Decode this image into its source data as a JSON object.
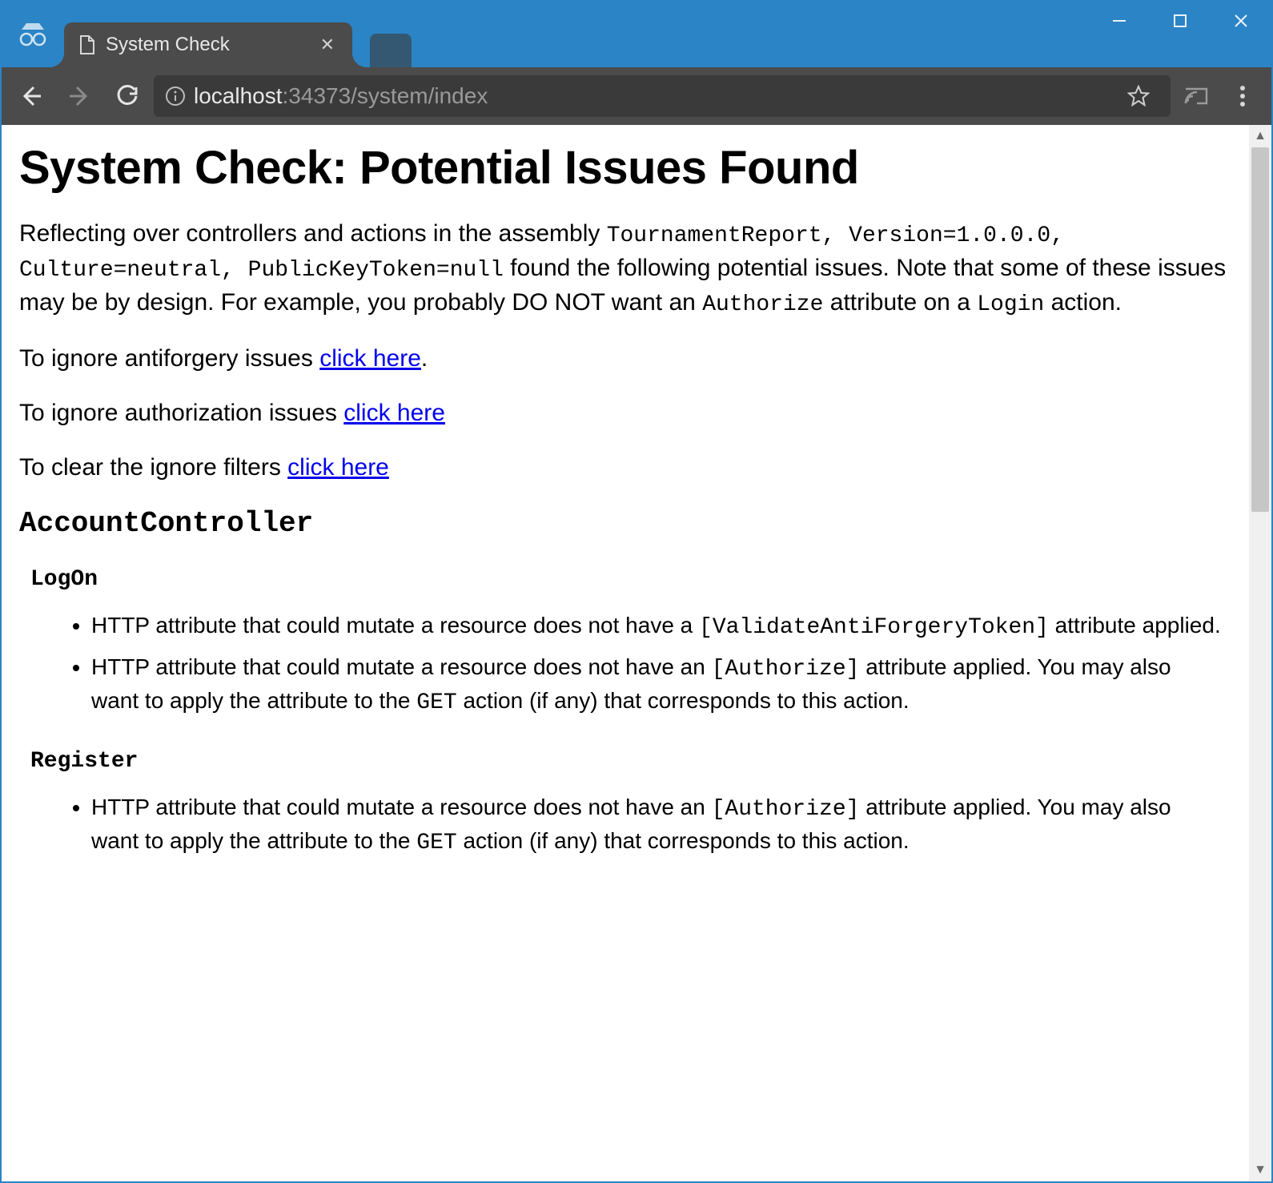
{
  "window": {
    "tab_title": "System Check",
    "url_host": "localhost",
    "url_rest": ":34373/system/index"
  },
  "page": {
    "h1": "System Check: Potential Issues Found",
    "intro_part1": "Reflecting over controllers and actions in the assembly ",
    "intro_mono1": "TournamentReport, Version=1.0.0.0, Culture=neutral, PublicKeyToken=null",
    "intro_part2": " found the following potential issues. Note that some of these issues may be by design. For example, you probably DO NOT want an ",
    "intro_mono2": "Authorize",
    "intro_part3": " attribute on a ",
    "intro_mono3": "Login",
    "intro_part4": " action.",
    "p2_text": "To ignore antiforgery issues ",
    "p2_link": "click here",
    "p2_after": ".",
    "p3_text": "To ignore authorization issues ",
    "p3_link": "click here",
    "p4_text": "To clear the ignore filters ",
    "p4_link": "click here",
    "controller": "AccountController",
    "action1": "LogOn",
    "action1_issue1_a": "HTTP attribute that could mutate a resource does not have a ",
    "action1_issue1_mono": "[ValidateAntiForgeryToken]",
    "action1_issue1_b": " attribute applied.",
    "action1_issue2_a": "HTTP attribute that could mutate a resource does not have an ",
    "action1_issue2_mono1": "[Authorize]",
    "action1_issue2_b": " attribute applied. You may also want to apply the attribute to the ",
    "action1_issue2_mono2": "GET",
    "action1_issue2_c": " action (if any) that corresponds to this action.",
    "action2": "Register",
    "action2_issue1_a": "HTTP attribute that could mutate a resource does not have an ",
    "action2_issue1_mono1": "[Authorize]",
    "action2_issue1_b": " attribute applied. You may also want to apply the attribute to the ",
    "action2_issue1_mono2": "GET",
    "action2_issue1_c": " action (if any) that corresponds to this action."
  }
}
